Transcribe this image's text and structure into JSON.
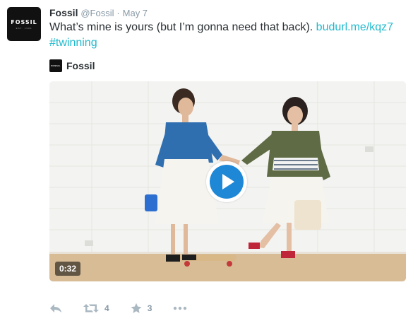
{
  "tweet": {
    "author_name": "Fossil",
    "author_handle": "@Fossil",
    "separator": "·",
    "time": "May 7",
    "text": "What’s mine is yours (but I’m gonna need that back).",
    "link": "budurl.me/kqz7",
    "hashtag": "#twinning"
  },
  "avatar": {
    "logo_text": "FOSSIL",
    "logo_sub": "EST. 1984"
  },
  "card": {
    "author_name": "Fossil",
    "logo_text": "FOSSIL",
    "video": {
      "duration": "0:32",
      "play_icon": "play-icon"
    }
  },
  "actions": {
    "reply": {
      "icon": "reply-icon"
    },
    "retweet": {
      "icon": "retweet-icon",
      "count": "4"
    },
    "favorite": {
      "icon": "star-icon",
      "count": "3"
    },
    "more": {
      "icon": "more-icon"
    }
  },
  "colors": {
    "link": "#1fb9cc",
    "play": "#1e88d6",
    "muted": "#8899a6",
    "action_icon": "#aab8c2"
  }
}
